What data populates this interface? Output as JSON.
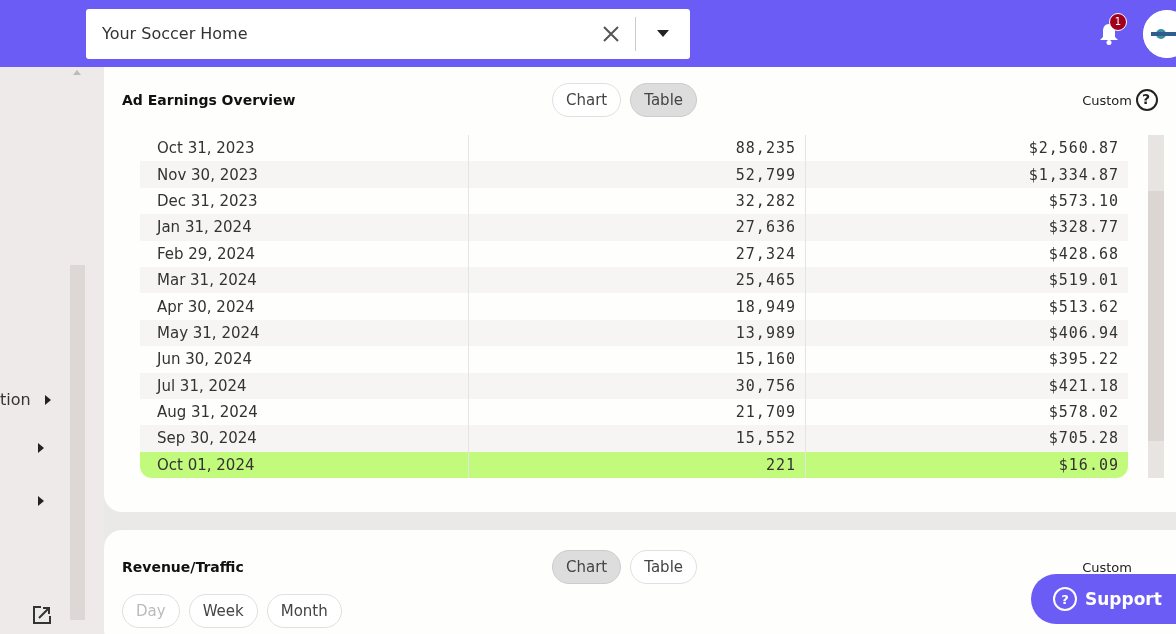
{
  "search": {
    "value": "Your Soccer Home"
  },
  "notifications": {
    "count": "1"
  },
  "sidebar": {
    "items": [
      {
        "label": "tion",
        "expanded": false
      },
      {
        "expanded": false
      },
      {
        "expanded": false
      }
    ]
  },
  "ad_earnings": {
    "title": "Ad Earnings Overview",
    "views": [
      {
        "label": "Chart",
        "selected": false
      },
      {
        "label": "Table",
        "selected": true
      }
    ],
    "range": "Custom",
    "help": "?",
    "rows": [
      {
        "date": "Oct 31, 2023",
        "count": "88,235",
        "amount": "$2,560.87",
        "highlighted": false
      },
      {
        "date": "Nov 30, 2023",
        "count": "52,799",
        "amount": "$1,334.87",
        "highlighted": false
      },
      {
        "date": "Dec 31, 2023",
        "count": "32,282",
        "amount": "$573.10",
        "highlighted": false
      },
      {
        "date": "Jan 31, 2024",
        "count": "27,636",
        "amount": "$328.77",
        "highlighted": false
      },
      {
        "date": "Feb 29, 2024",
        "count": "27,324",
        "amount": "$428.68",
        "highlighted": false
      },
      {
        "date": "Mar 31, 2024",
        "count": "25,465",
        "amount": "$519.01",
        "highlighted": false
      },
      {
        "date": "Apr 30, 2024",
        "count": "18,949",
        "amount": "$513.62",
        "highlighted": false
      },
      {
        "date": "May 31, 2024",
        "count": "13,989",
        "amount": "$406.94",
        "highlighted": false
      },
      {
        "date": "Jun 30, 2024",
        "count": "15,160",
        "amount": "$395.22",
        "highlighted": false
      },
      {
        "date": "Jul 31, 2024",
        "count": "30,756",
        "amount": "$421.18",
        "highlighted": false
      },
      {
        "date": "Aug 31, 2024",
        "count": "21,709",
        "amount": "$578.02",
        "highlighted": false
      },
      {
        "date": "Sep 30, 2024",
        "count": "15,552",
        "amount": "$705.28",
        "highlighted": false
      },
      {
        "date": "Oct 01, 2024",
        "count": "221",
        "amount": "$16.09",
        "highlighted": true
      }
    ]
  },
  "revenue_traffic": {
    "title": "Revenue/Traffic",
    "views": [
      {
        "label": "Chart",
        "selected": true
      },
      {
        "label": "Table",
        "selected": false
      }
    ],
    "range": "Custom",
    "periods": [
      {
        "label": "Day",
        "disabled": true
      },
      {
        "label": "Week",
        "disabled": false
      },
      {
        "label": "Month",
        "disabled": false
      }
    ]
  },
  "support": {
    "label": "Support",
    "icon": "?"
  }
}
